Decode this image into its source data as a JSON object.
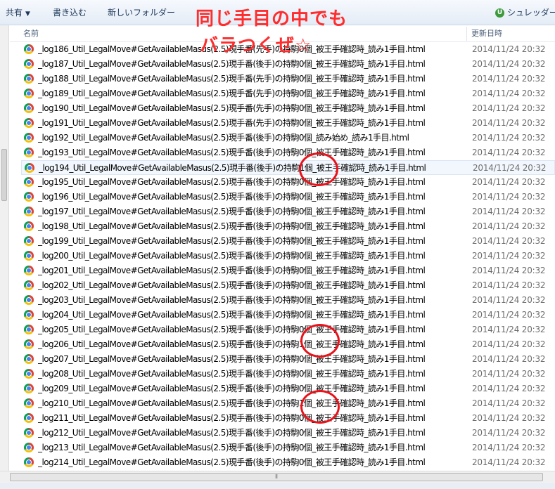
{
  "toolbar": {
    "share_label": "共有",
    "burn_label": "書き込む",
    "new_folder_label": "新しいフォルダー",
    "shredder_badge": "U",
    "shredder_label": "シュレッダー"
  },
  "header": {
    "name_col": "名前",
    "date_col": "更新日時"
  },
  "annotation": {
    "line1": "同じ手目の中でも",
    "line2": "バラつくぜ☆",
    "color": "#ff2d2d"
  },
  "selected_index": 8,
  "files": [
    {
      "name": "_log186_Util_LegalMove#GetAvailableMasus(2.5)現手番(先手)の持駒0個_被王手確認時_読み1手目.html",
      "date": "2014/11/24 20:32"
    },
    {
      "name": "_log187_Util_LegalMove#GetAvailableMasus(2.5)現手番(後手)の持駒0個_被王手確認時_読み1手目.html",
      "date": "2014/11/24 20:32"
    },
    {
      "name": "_log188_Util_LegalMove#GetAvailableMasus(2.5)現手番(先手)の持駒0個_被王手確認時_読み1手目.html",
      "date": "2014/11/24 20:32"
    },
    {
      "name": "_log189_Util_LegalMove#GetAvailableMasus(2.5)現手番(先手)の持駒0個_被王手確認時_読み1手目.html",
      "date": "2014/11/24 20:32"
    },
    {
      "name": "_log190_Util_LegalMove#GetAvailableMasus(2.5)現手番(先手)の持駒0個_被王手確認時_読み1手目.html",
      "date": "2014/11/24 20:32"
    },
    {
      "name": "_log191_Util_LegalMove#GetAvailableMasus(2.5)現手番(先手)の持駒0個_被王手確認時_読み1手目.html",
      "date": "2014/11/24 20:32"
    },
    {
      "name": "_log192_Util_LegalMove#GetAvailableMasus(2.5)現手番(後手)の持駒0個_読み始め_読み1手目.html",
      "date": "2014/11/24 20:32"
    },
    {
      "name": "_log193_Util_LegalMove#GetAvailableMasus(2.5)現手番(後手)の持駒0個_被王手確認時_読み1手目.html",
      "date": "2014/11/24 20:32"
    },
    {
      "name": "_log194_Util_LegalMove#GetAvailableMasus(2.5)現手番(後手)の持駒1個_被王手確認時_読み1手目.html",
      "date": "2014/11/24 20:32"
    },
    {
      "name": "_log195_Util_LegalMove#GetAvailableMasus(2.5)現手番(後手)の持駒0個_被王手確認時_読み1手目.html",
      "date": "2014/11/24 20:32"
    },
    {
      "name": "_log196_Util_LegalMove#GetAvailableMasus(2.5)現手番(後手)の持駒0個_被王手確認時_読み1手目.html",
      "date": "2014/11/24 20:32"
    },
    {
      "name": "_log197_Util_LegalMove#GetAvailableMasus(2.5)現手番(後手)の持駒0個_被王手確認時_読み1手目.html",
      "date": "2014/11/24 20:32"
    },
    {
      "name": "_log198_Util_LegalMove#GetAvailableMasus(2.5)現手番(後手)の持駒0個_被王手確認時_読み1手目.html",
      "date": "2014/11/24 20:32"
    },
    {
      "name": "_log199_Util_LegalMove#GetAvailableMasus(2.5)現手番(後手)の持駒0個_被王手確認時_読み1手目.html",
      "date": "2014/11/24 20:32"
    },
    {
      "name": "_log200_Util_LegalMove#GetAvailableMasus(2.5)現手番(後手)の持駒0個_被王手確認時_読み1手目.html",
      "date": "2014/11/24 20:32"
    },
    {
      "name": "_log201_Util_LegalMove#GetAvailableMasus(2.5)現手番(後手)の持駒0個_被王手確認時_読み1手目.html",
      "date": "2014/11/24 20:32"
    },
    {
      "name": "_log202_Util_LegalMove#GetAvailableMasus(2.5)現手番(後手)の持駒0個_被王手確認時_読み1手目.html",
      "date": "2014/11/24 20:32"
    },
    {
      "name": "_log203_Util_LegalMove#GetAvailableMasus(2.5)現手番(後手)の持駒0個_被王手確認時_読み1手目.html",
      "date": "2014/11/24 20:32"
    },
    {
      "name": "_log204_Util_LegalMove#GetAvailableMasus(2.5)現手番(後手)の持駒0個_被王手確認時_読み1手目.html",
      "date": "2014/11/24 20:32"
    },
    {
      "name": "_log205_Util_LegalMove#GetAvailableMasus(2.5)現手番(後手)の持駒0個_被王手確認時_読み1手目.html",
      "date": "2014/11/24 20:32"
    },
    {
      "name": "_log206_Util_LegalMove#GetAvailableMasus(2.5)現手番(後手)の持駒1個_被王手確認時_読み1手目.html",
      "date": "2014/11/24 20:32"
    },
    {
      "name": "_log207_Util_LegalMove#GetAvailableMasus(2.5)現手番(後手)の持駒0個_被王手確認時_読み1手目.html",
      "date": "2014/11/24 20:32"
    },
    {
      "name": "_log208_Util_LegalMove#GetAvailableMasus(2.5)現手番(後手)の持駒0個_被王手確認時_読み1手目.html",
      "date": "2014/11/24 20:32"
    },
    {
      "name": "_log209_Util_LegalMove#GetAvailableMasus(2.5)現手番(後手)の持駒0個_被王手確認時_読み1手目.html",
      "date": "2014/11/24 20:32"
    },
    {
      "name": "_log210_Util_LegalMove#GetAvailableMasus(2.5)現手番(後手)の持駒1個_被王手確認時_読み1手目.html",
      "date": "2014/11/24 20:32"
    },
    {
      "name": "_log211_Util_LegalMove#GetAvailableMasus(2.5)現手番(後手)の持駒0個_被王手確認時_読み1手目.html",
      "date": "2014/11/24 20:32"
    },
    {
      "name": "_log212_Util_LegalMove#GetAvailableMasus(2.5)現手番(後手)の持駒0個_被王手確認時_読み1手目.html",
      "date": "2014/11/24 20:32"
    },
    {
      "name": "_log213_Util_LegalMove#GetAvailableMasus(2.5)現手番(後手)の持駒0個_被王手確認時_読み1手目.html",
      "date": "2014/11/24 20:32"
    },
    {
      "name": "_log214_Util_LegalMove#GetAvailableMasus(2.5)現手番(後手)の持駒0個_被王手確認時_読み1手目.html",
      "date": "2014/11/24 20:32"
    }
  ]
}
